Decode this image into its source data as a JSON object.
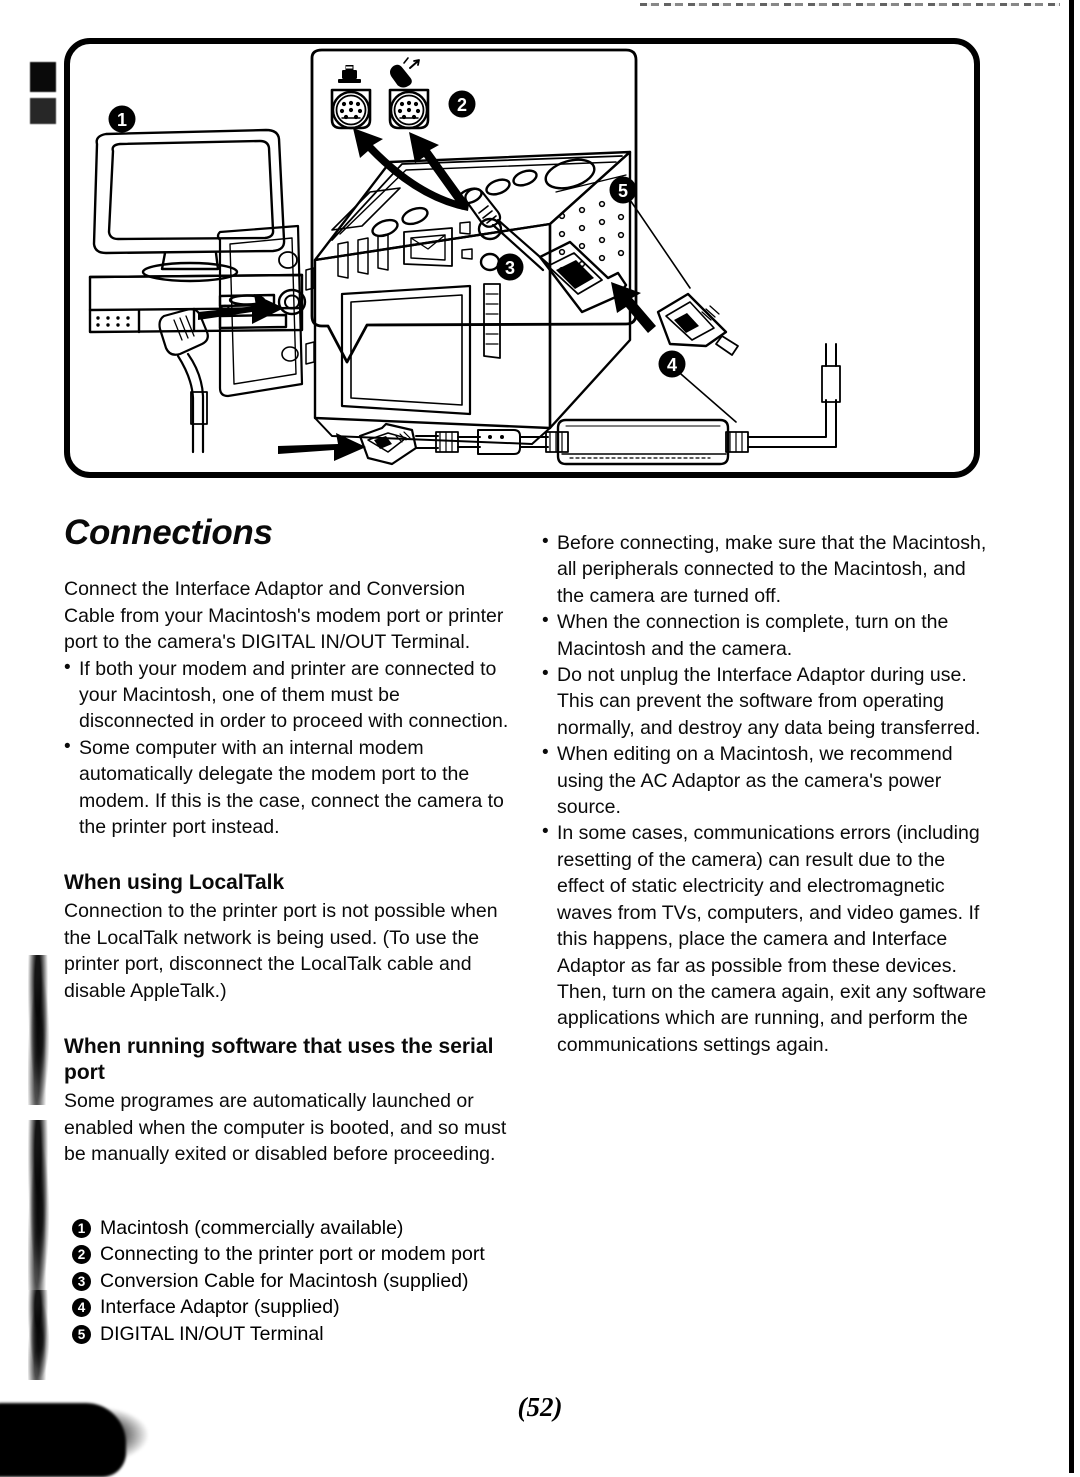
{
  "page": {
    "number_label": "(52)"
  },
  "figure": {
    "callouts": [
      {
        "id": "1",
        "target": "macintosh-computer"
      },
      {
        "id": "2",
        "target": "printer-and-modem-ports"
      },
      {
        "id": "3",
        "target": "conversion-cable"
      },
      {
        "id": "4",
        "target": "interface-adaptor"
      },
      {
        "id": "5",
        "target": "digital-in-out-terminal"
      }
    ],
    "port_icons": [
      {
        "name": "printer-port-icon"
      },
      {
        "name": "modem-port-icon"
      }
    ]
  },
  "left_column": {
    "title": "Connections",
    "intro": "Connect the Interface Adaptor and Conversion Cable from your Macintosh's modem port or printer port to the camera's DIGITAL IN/OUT Terminal.",
    "intro_bullets": [
      "If both your modem and printer are connected to your Macintosh, one of them must be disconnected in order to proceed with connection.",
      "Some computer with an internal modem automatically delegate the modem port to the modem. If this is the case, connect the camera to the printer port instead."
    ],
    "localtalk_heading": "When using LocalTalk",
    "localtalk_body": "Connection to the printer port is not possible when the LocalTalk network is being used. (To use the printer port, disconnect the LocalTalk cable and disable AppleTalk.)",
    "serial_heading": "When running software that uses the serial port",
    "serial_body": "Some programes are automatically launched or enabled when the computer is booted, and so must be manually exited or disabled before proceeding."
  },
  "right_column": {
    "bullets": [
      "Before connecting, make sure that the Macintosh, all peripherals connected to the Macintosh, and the camera are turned off.",
      "When the connection is complete, turn on the Macintosh and the camera.",
      "Do not unplug the Interface Adaptor during use. This can prevent the software from operating normally, and destroy any data being transferred.",
      "When editing on a Macintosh, we recommend using the AC Adaptor as the camera's power source.",
      "In some cases, communications errors (including resetting of the camera) can result due to the effect of static electricity and electromagnetic waves from TVs, computers, and video games. If this happens, place the camera and Interface Adaptor as far as possible from these devices. Then, turn on the camera again, exit any software applications which are running, and perform the communications settings again."
    ]
  },
  "legend": {
    "items": [
      {
        "number": "1",
        "text": "Macintosh (commercially available)"
      },
      {
        "number": "2",
        "text": "Connecting to the printer port or modem port"
      },
      {
        "number": "3",
        "text": "Conversion Cable for Macintosh (supplied)"
      },
      {
        "number": "4",
        "text": "Interface Adaptor (supplied)"
      },
      {
        "number": "5",
        "text": "DIGITAL IN/OUT Terminal"
      }
    ]
  }
}
